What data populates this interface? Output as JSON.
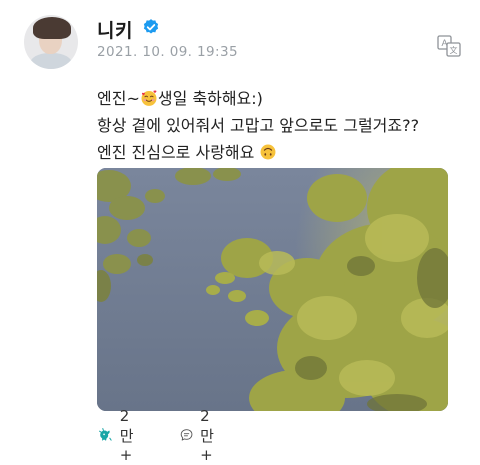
{
  "post": {
    "author": "니키",
    "timestamp": "2021. 10. 09. 19:35",
    "lines": [
      {
        "before": "엔진~",
        "emoji": "smiling-face-with-hearts",
        "after": "생일 축하해요:)"
      },
      {
        "text": "항상 곁에 있어줘서 고맙고 앞으로도 그럴거죠??"
      },
      {
        "before": "엔진 진심으로 사랑해요",
        "emoji": "upside-down-face",
        "after": ""
      }
    ]
  },
  "actions": {
    "likes": "2만+",
    "comments": "2만+"
  },
  "colors": {
    "verified": "#1d9bf0",
    "like_icon": "#1aa6a6",
    "sky": "#6f7c93",
    "leaves": "#a9b04a"
  },
  "icons": [
    "verified-badge-icon",
    "translate-icon",
    "like-icon",
    "comment-icon"
  ]
}
